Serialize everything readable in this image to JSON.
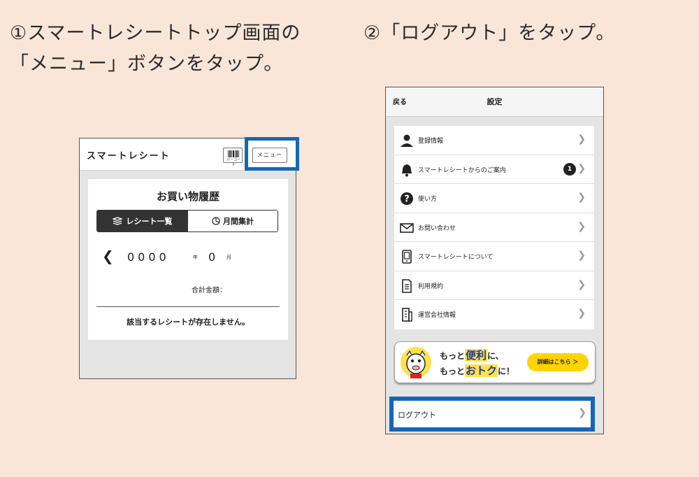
{
  "instructions": {
    "step1_line1": "①スマートレシートトップ画面の",
    "step1_line2": "「メニュー」ボタンをタップ。",
    "step2": "②「ログアウト」をタップ。"
  },
  "screen1": {
    "app_title": "スマートレシート",
    "barcode_label": "バーコード",
    "menu_button": "メニュー",
    "heading": "お買い物履歴",
    "tab_receipts": "レシート一覧",
    "tab_monthly": "月間集計",
    "prev_arrow": "❮",
    "year": "0000",
    "year_unit": "年",
    "month": "0",
    "month_unit": "月",
    "total_label": "合計金額：",
    "empty_message": "該当するレシートが存在しません。"
  },
  "screen2": {
    "back_button": "戻る",
    "title": "設定",
    "items": [
      {
        "label": "登録情報",
        "icon": "person-icon"
      },
      {
        "label": "スマートレシートからのご案内",
        "icon": "bell-icon",
        "badge": "1"
      },
      {
        "label": "使い方",
        "icon": "question-icon"
      },
      {
        "label": "お問い合わせ",
        "icon": "mail-icon"
      },
      {
        "label": "スマートレシートについて",
        "icon": "phone-icon"
      },
      {
        "label": "利用規約",
        "icon": "document-icon"
      },
      {
        "label": "運営会社情報",
        "icon": "building-icon"
      }
    ],
    "banner": {
      "line1_pre": "もっと",
      "line1_hl": "便利",
      "line1_post": "に、",
      "line2_pre": "もっと",
      "line2_hl": "おトク",
      "line2_post": "に！",
      "button": "詳細はこちら ＞"
    },
    "logout": "ログアウト"
  },
  "colors": {
    "background": "#fae6d8",
    "highlight_border": "#1566b8",
    "banner_button": "#ffd400"
  }
}
